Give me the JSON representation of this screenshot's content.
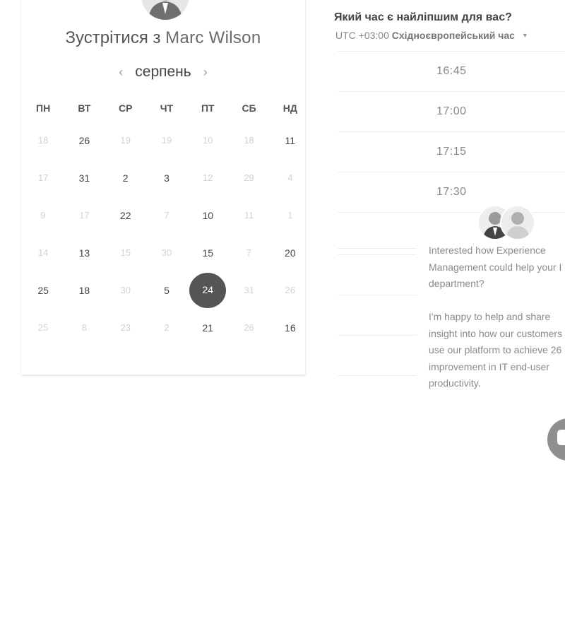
{
  "header": {
    "title_prefix": "Зустрітися з",
    "host_name": "Marc Wilson"
  },
  "calendar": {
    "month": "серпень",
    "prev_icon": "‹",
    "next_icon": "›",
    "weekdays": [
      "ПН",
      "ВТ",
      "СР",
      "ЧТ",
      "ПТ",
      "СБ",
      "НД"
    ],
    "weeks": [
      [
        {
          "d": "18",
          "muted": true
        },
        {
          "d": "26",
          "muted": false
        },
        {
          "d": "19",
          "muted": true
        },
        {
          "d": "19",
          "muted": true
        },
        {
          "d": "10",
          "muted": true
        },
        {
          "d": "18",
          "muted": true
        },
        {
          "d": "11",
          "muted": false
        }
      ],
      [
        {
          "d": "17",
          "muted": true
        },
        {
          "d": "31",
          "muted": false
        },
        {
          "d": "2",
          "muted": false
        },
        {
          "d": "3",
          "muted": false
        },
        {
          "d": "12",
          "muted": true
        },
        {
          "d": "29",
          "muted": true
        },
        {
          "d": "4",
          "muted": true
        }
      ],
      [
        {
          "d": "9",
          "muted": true
        },
        {
          "d": "17",
          "muted": true
        },
        {
          "d": "22",
          "muted": false
        },
        {
          "d": "7",
          "muted": true
        },
        {
          "d": "10",
          "muted": false
        },
        {
          "d": "11",
          "muted": true
        },
        {
          "d": "1",
          "muted": true
        }
      ],
      [
        {
          "d": "14",
          "muted": true
        },
        {
          "d": "13",
          "muted": false
        },
        {
          "d": "15",
          "muted": true
        },
        {
          "d": "30",
          "muted": true
        },
        {
          "d": "15",
          "muted": false
        },
        {
          "d": "7",
          "muted": true
        },
        {
          "d": "20",
          "muted": false
        }
      ],
      [
        {
          "d": "25",
          "muted": false
        },
        {
          "d": "18",
          "muted": false
        },
        {
          "d": "30",
          "muted": true
        },
        {
          "d": "5",
          "muted": false
        },
        {
          "d": "24",
          "muted": false,
          "selected": true
        },
        {
          "d": "31",
          "muted": true
        },
        {
          "d": "26",
          "muted": true
        }
      ],
      [
        {
          "d": "25",
          "muted": true
        },
        {
          "d": "8",
          "muted": true
        },
        {
          "d": "23",
          "muted": true
        },
        {
          "d": "2",
          "muted": true
        },
        {
          "d": "21",
          "muted": false
        },
        {
          "d": "26",
          "muted": true
        },
        {
          "d": "16",
          "muted": false
        }
      ]
    ]
  },
  "timezone": {
    "question": "Який час є найліпшим для вас?",
    "offset": "UTC +03:00",
    "name": "Східноєвропейський час"
  },
  "slots": [
    "16:45",
    "17:00",
    "17:15",
    "17:30"
  ],
  "chat": {
    "message": "Interested how Experience\nManagement could help your I\ndepartment?\n\nI'm happy to help and share\ninsight into how our customers\nuse our platform to achieve 26\nimprovement in IT end-user\nproductivity."
  },
  "colors": {
    "selected_day_bg": "#555555",
    "muted_day": "#d2d2d2",
    "chat_button": "#8f8f8f"
  }
}
